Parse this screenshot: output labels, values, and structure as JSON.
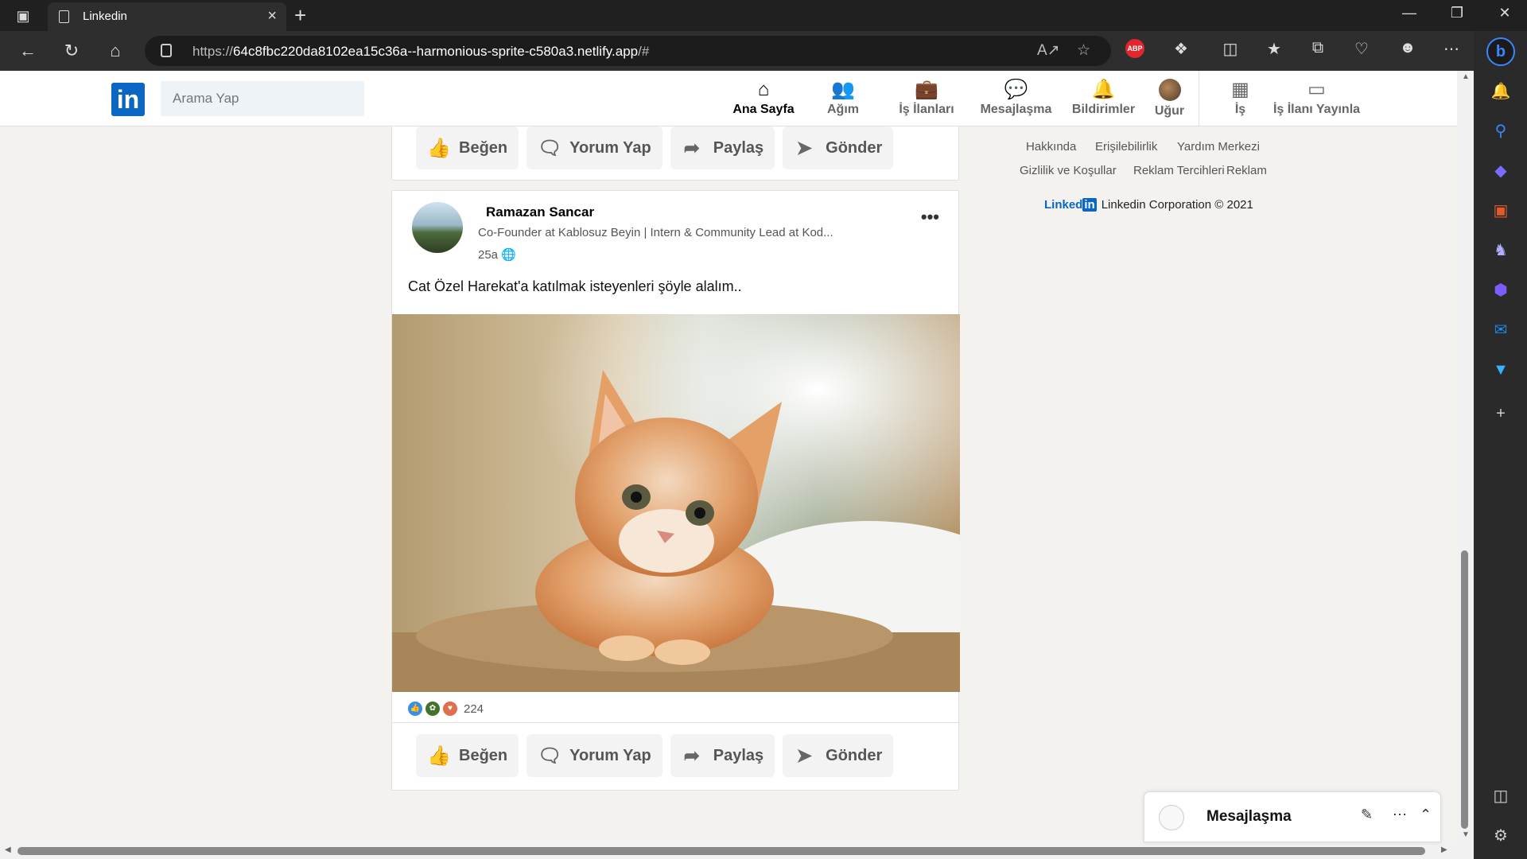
{
  "browser": {
    "tab_title": "Linkedin",
    "url_prefix": "https://",
    "url_host": "64c8fbc220da8102ea15c36a--harmonious-sprite-c580a3.netlify.app",
    "url_suffix": "/#",
    "abp_label": "ABP",
    "bing_label": "b"
  },
  "header": {
    "logo": "in",
    "search_placeholder": "Arama Yap",
    "nav": [
      {
        "label": "Ana Sayfa",
        "icon": "home-icon"
      },
      {
        "label": "Ağım",
        "icon": "people-icon"
      },
      {
        "label": "İş İlanları",
        "icon": "briefcase-icon"
      },
      {
        "label": "Mesajlaşma",
        "icon": "chat-icon"
      },
      {
        "label": "Bildirimler",
        "icon": "bell-icon"
      },
      {
        "label": "Uğur",
        "icon": "avatar"
      },
      {
        "label": "İş",
        "icon": "grid-icon"
      },
      {
        "label": "İş İlanı Yayınla",
        "icon": "post-job-icon"
      }
    ]
  },
  "actions": {
    "like": "Beğen",
    "comment": "Yorum Yap",
    "share": "Paylaş",
    "send": "Gönder"
  },
  "post": {
    "author": "Ramazan Sancar",
    "headline": "Co-Founder at Kablosuz Beyin | Intern & Community Lead at Kod...",
    "time": "25a",
    "more": "•••",
    "text": "Cat Özel Harekat'a katılmak isteyenleri şöyle alalım..",
    "reaction_count": "224"
  },
  "footer": {
    "links": [
      "Hakkında",
      "Erişilebilirlik",
      "Yardım Merkezi",
      "Gizlilik ve Koşullar",
      "Reklam Tercihleri",
      "Reklam"
    ],
    "brand_text": "Linked",
    "brand_in": "in",
    "corporation": "Linkedin Corporation © 2021"
  },
  "messaging": {
    "title": "Mesajlaşma"
  },
  "colors": {
    "brand": "#0a66c2",
    "page_bg": "#f3f2ef"
  }
}
